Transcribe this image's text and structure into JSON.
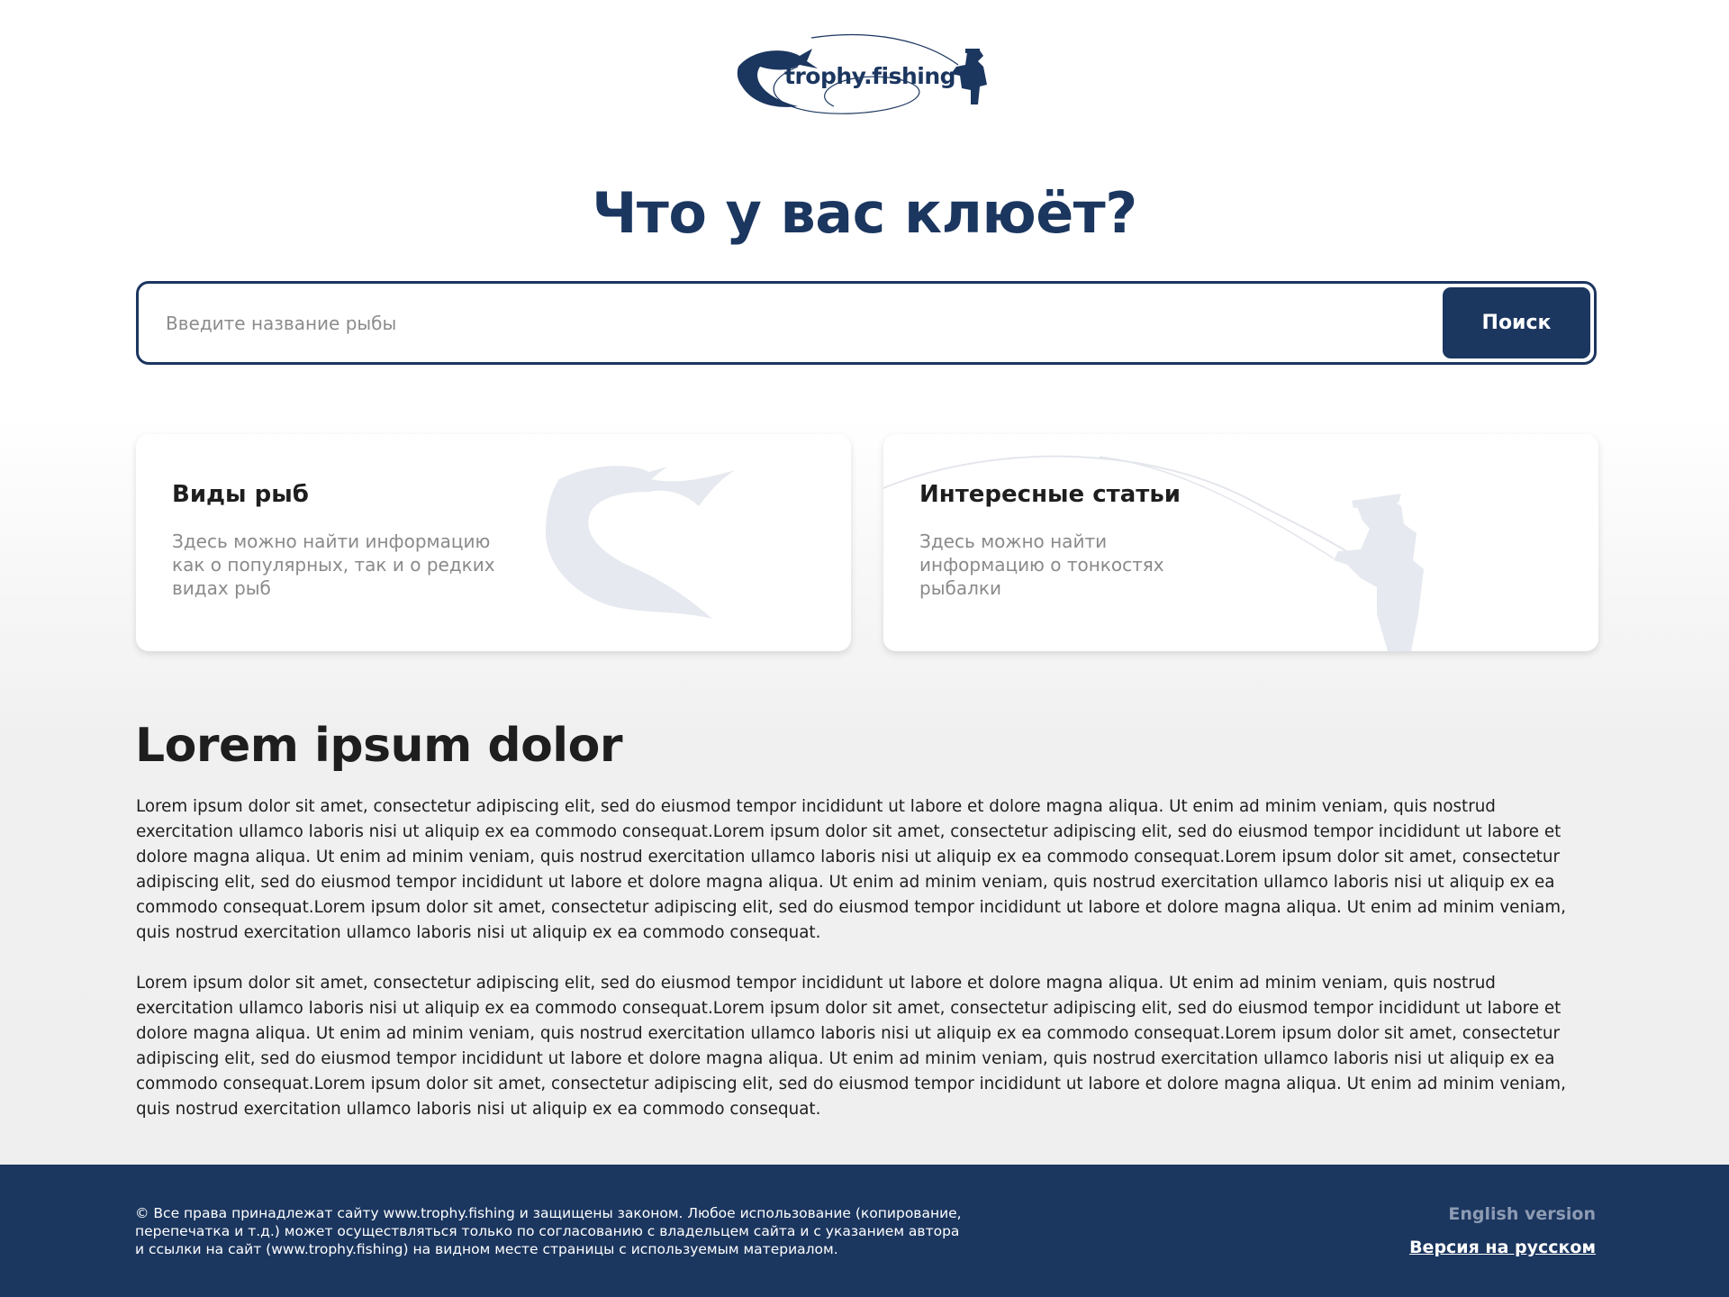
{
  "logo": {
    "text": "trophy.fishing"
  },
  "hero": {
    "title": "Что у вас клюёт?"
  },
  "search": {
    "placeholder": "Введите название рыбы",
    "button_label": "Поиск"
  },
  "cards": [
    {
      "title": "Виды рыб",
      "text": "Здесь можно найти информацию как о популярных, так и о редких видах рыб",
      "icon": "fish-silhouette-icon"
    },
    {
      "title": "Интересные статьи",
      "text": "Здесь можно найти информацию о тонкостях рыбалки",
      "icon": "fisherman-silhouette-icon"
    }
  ],
  "article": {
    "title": "Lorem ipsum dolor",
    "paragraphs": [
      "Lorem ipsum dolor sit amet, consectetur adipiscing elit, sed do eiusmod tempor incididunt ut labore et dolore magna aliqua. Ut enim ad minim veniam, quis nostrud exercitation ullamco laboris nisi ut aliquip ex ea commodo consequat.Lorem ipsum dolor sit amet, consectetur adipiscing elit, sed do eiusmod tempor incididunt ut labore et dolore magna aliqua. Ut enim ad minim veniam, quis nostrud exercitation ullamco laboris nisi ut aliquip ex ea commodo consequat.Lorem ipsum dolor sit amet, consectetur adipiscing elit, sed do eiusmod tempor incididunt ut labore et dolore magna aliqua. Ut enim ad minim veniam, quis nostrud exercitation ullamco laboris nisi ut aliquip ex ea commodo consequat.Lorem ipsum dolor sit amet, consectetur adipiscing elit, sed do eiusmod tempor incididunt ut labore et dolore magna aliqua. Ut enim ad minim veniam, quis nostrud exercitation ullamco laboris nisi ut aliquip ex ea commodo consequat.",
      "Lorem ipsum dolor sit amet, consectetur adipiscing elit, sed do eiusmod tempor incididunt ut labore et dolore magna aliqua. Ut enim ad minim veniam, quis nostrud exercitation ullamco laboris nisi ut aliquip ex ea commodo consequat.Lorem ipsum dolor sit amet, consectetur adipiscing elit, sed do eiusmod tempor incididunt ut labore et dolore magna aliqua. Ut enim ad minim veniam, quis nostrud exercitation ullamco laboris nisi ut aliquip ex ea commodo consequat.Lorem ipsum dolor sit amet, consectetur adipiscing elit, sed do eiusmod tempor incididunt ut labore et dolore magna aliqua. Ut enim ad minim veniam, quis nostrud exercitation ullamco laboris nisi ut aliquip ex ea commodo consequat.Lorem ipsum dolor sit amet, consectetur adipiscing elit, sed do eiusmod tempor incididunt ut labore et dolore magna aliqua. Ut enim ad minim veniam, quis nostrud exercitation ullamco laboris nisi ut aliquip ex ea commodo consequat."
    ]
  },
  "footer": {
    "copyright": "© Все права принадлежат сайту www.trophy.fishing и защищены законом. Любое использование (копирование, перепечатка и т.д.) может осуществляться только по согласованию с владельцем сайта и с указанием автора и ссылки на сайт (www.trophy.fishing) на видном месте страницы с используемым материалом.",
    "lang_en": "English version",
    "lang_ru": "Версия на русском"
  },
  "colors": {
    "brand": "#1b365f",
    "text": "#1e1e1e",
    "muted": "#8a8a8a",
    "footer_inactive_link": "#8d9bb3"
  }
}
